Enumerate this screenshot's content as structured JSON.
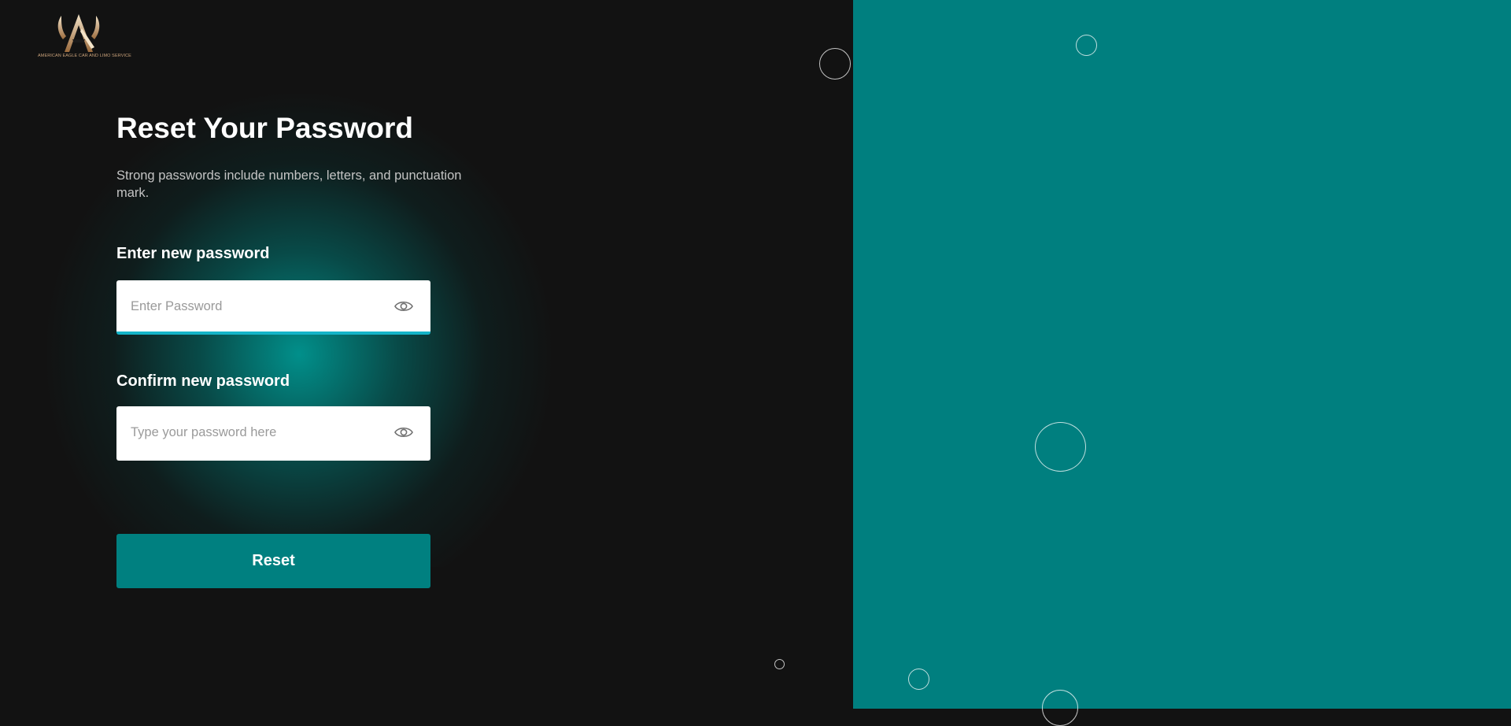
{
  "logo": {
    "text": "AMERICAN EAGLE CAR AND LIMO SERVICE"
  },
  "page": {
    "title": "Reset Your Password",
    "subtitle": "Strong passwords include numbers, letters, and punctuation mark."
  },
  "form": {
    "new_password": {
      "label": "Enter new password",
      "placeholder": "Enter Password",
      "value": ""
    },
    "confirm_password": {
      "label": "Confirm new password",
      "placeholder": "Type your password here",
      "value": ""
    },
    "submit_label": "Reset"
  },
  "colors": {
    "background": "#121212",
    "accent_teal": "#008080",
    "focus_underline": "#14b4c8",
    "text_primary": "#ffffff",
    "text_secondary": "#c4c4c4"
  },
  "icons": {
    "password_toggle": "eye-icon"
  }
}
